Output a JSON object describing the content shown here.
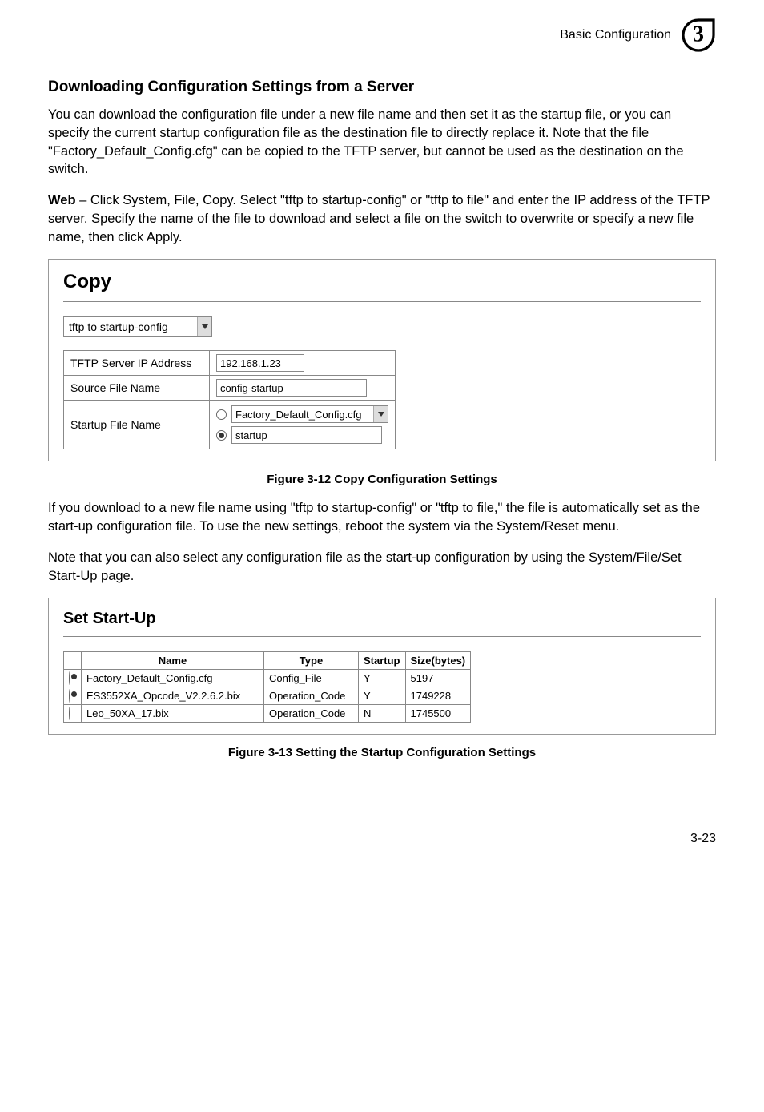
{
  "header": {
    "section": "Basic Configuration",
    "chapter": "3"
  },
  "heading1": "Downloading Configuration Settings from a Server",
  "para1": "You can download the configuration file under a new file name and then set it as the startup file, or you can specify the current startup configuration file as the destination file to directly replace it. Note that the file \"Factory_Default_Config.cfg\" can be copied to the TFTP server, but cannot be used as the destination on the switch.",
  "para2_prefix": "Web",
  "para2_rest": " – Click System, File, Copy. Select \"tftp to startup-config\" or \"tftp to file\" and enter the IP address of the TFTP server. Specify the name of the file to download and select a file on the switch to overwrite or specify a new file name, then click Apply.",
  "copy": {
    "title": "Copy",
    "mode": "tftp to startup-config",
    "rows": {
      "tftp_label": "TFTP Server IP Address",
      "tftp_value": "192.168.1.23",
      "source_label": "Source File Name",
      "source_value": "config-startup",
      "startup_label": "Startup File Name",
      "opt1": "Factory_Default_Config.cfg",
      "opt2_value": "startup"
    }
  },
  "figure1": "Figure 3-12  Copy Configuration Settings",
  "para3": "If you download to a new file name using \"tftp to startup-config\" or \"tftp to file,\" the file is automatically set as the start-up configuration file. To use the new settings, reboot the system via the System/Reset menu.",
  "para4": "Note that you can also select any configuration file as the start-up configuration by using the System/File/Set Start-Up page.",
  "startup": {
    "title": "Set Start-Up",
    "columns": {
      "c1": "Name",
      "c2": "Type",
      "c3": "Startup",
      "c4": "Size(bytes)"
    },
    "rows": [
      {
        "selected": true,
        "name": "Factory_Default_Config.cfg",
        "type": "Config_File",
        "startup": "Y",
        "size": "5197"
      },
      {
        "selected": true,
        "name": "ES3552XA_Opcode_V2.2.6.2.bix",
        "type": "Operation_Code",
        "startup": "Y",
        "size": "1749228"
      },
      {
        "selected": false,
        "name": "Leo_50XA_17.bix",
        "type": "Operation_Code",
        "startup": "N",
        "size": "1745500"
      }
    ]
  },
  "figure2": "Figure 3-13  Setting the Startup Configuration Settings",
  "page_number": "3-23"
}
